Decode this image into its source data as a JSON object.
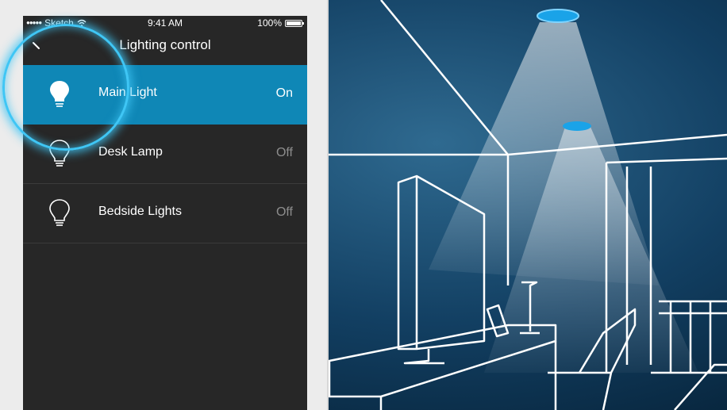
{
  "status_bar": {
    "carrier": "Sketch",
    "time": "9:41 AM",
    "battery": "100%"
  },
  "nav": {
    "title": "Lighting control"
  },
  "lights": [
    {
      "name": "Main Light",
      "state": "On",
      "active": true
    },
    {
      "name": "Desk Lamp",
      "state": "Off",
      "active": false
    },
    {
      "name": "Bedside Lights",
      "state": "Off",
      "active": false
    }
  ],
  "icons": {
    "back": "back-icon",
    "bulb": "lightbulb-icon",
    "wifi": "wifi-icon",
    "battery": "battery-icon"
  },
  "colors": {
    "accent": "#0f87b6",
    "highlight_ring": "#3fc6f5",
    "screen_bg": "#272727",
    "illustration_bg": "#0b2d47",
    "line_art": "#ffffff"
  }
}
